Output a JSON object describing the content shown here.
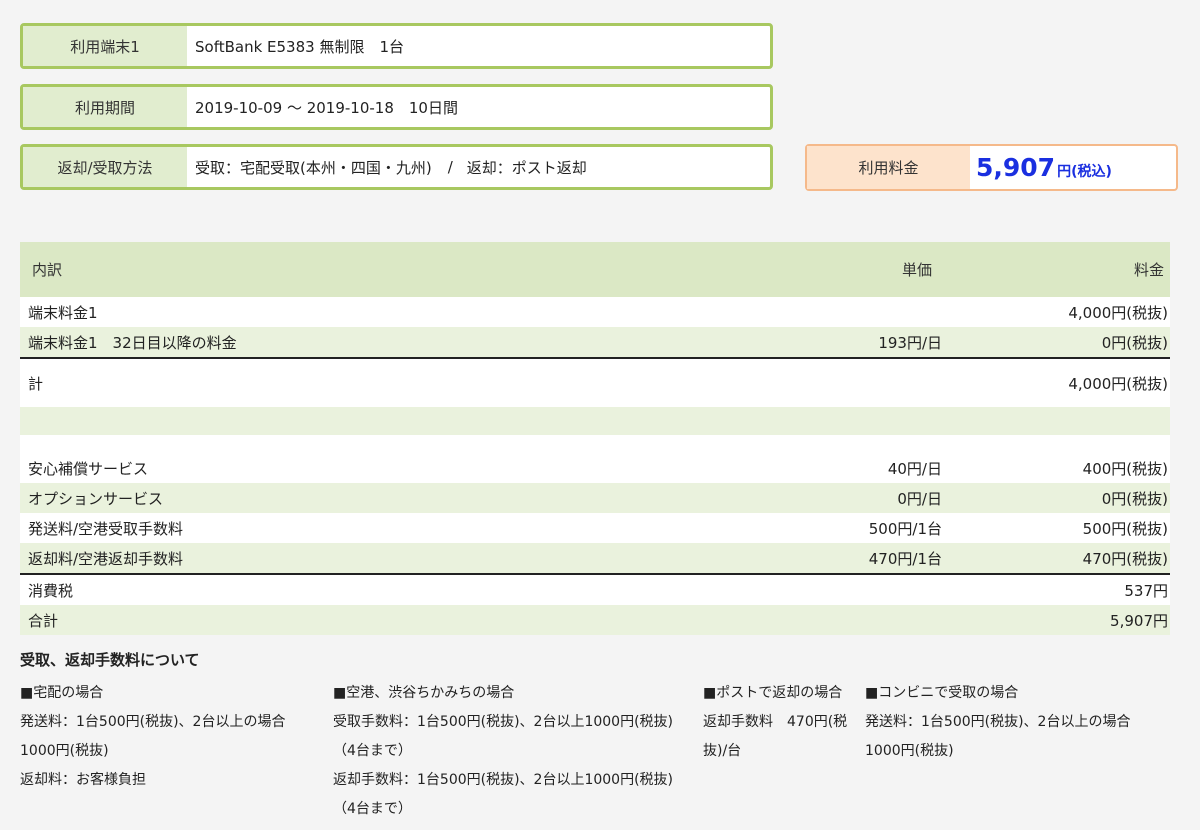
{
  "summary": {
    "device": {
      "label": "利用端末1",
      "value": "SoftBank E5383 無制限　1台"
    },
    "period": {
      "label": "利用期間",
      "value": "2019-10-09 〜 2019-10-18　10日間"
    },
    "method": {
      "label": "返却/受取方法",
      "receive": "受取：宅配受取(本州・四国・九州)",
      "separator": "/",
      "return": "返却：ポスト返却"
    },
    "price": {
      "label": "利用料金",
      "amount": "5,907",
      "suffix": "円(税込)"
    }
  },
  "breakdown": {
    "headers": {
      "item": "内訳",
      "unit_price": "単価",
      "fee": "料金"
    },
    "device_rows": [
      {
        "item": "端末料金1",
        "unit_price": "",
        "fee": "4,000円(税抜)"
      },
      {
        "item": "端末料金1　32日目以降の料金",
        "unit_price": "193円/日",
        "fee": "0円(税抜)"
      }
    ],
    "subtotal": {
      "item": "計",
      "fee": "4,000円(税抜)"
    },
    "service_rows": [
      {
        "item": "安心補償サービス",
        "unit_price": "40円/日",
        "fee": "400円(税抜)"
      },
      {
        "item": "オプションサービス",
        "unit_price": "0円/日",
        "fee": "0円(税抜)"
      },
      {
        "item": "発送料/空港受取手数料",
        "unit_price": "500円/1台",
        "fee": "500円(税抜)"
      },
      {
        "item": "返却料/空港返却手数料",
        "unit_price": "470円/1台",
        "fee": "470円(税抜)"
      }
    ],
    "tax": {
      "item": "消費税",
      "fee": "537円"
    },
    "total": {
      "item": "合計",
      "fee": "5,907円"
    }
  },
  "notes": {
    "title": "受取、返却手数料について",
    "home": {
      "heading": "■宅配の場合",
      "lines": [
        "発送料：1台500円(税抜)、2台以上の場合",
        "1000円(税抜)",
        "返却料：お客様負担"
      ]
    },
    "airport": {
      "heading": "■空港、渋谷ちかみちの場合",
      "lines": [
        "受取手数料：1台500円(税抜)、2台以上1000円(税抜)",
        "（4台まで）",
        "返却手数料：1台500円(税抜)、2台以上1000円(税抜)",
        "（4台まで）"
      ]
    },
    "post": {
      "heading": "■ポストで返却の場合",
      "lines": [
        "返却手数料　470円(税",
        "抜)/台"
      ]
    },
    "convenience": {
      "heading": "■コンビニで受取の場合",
      "lines": [
        "発送料：1台500円(税抜)、2台以上の場合",
        "1000円(税抜)"
      ]
    }
  }
}
